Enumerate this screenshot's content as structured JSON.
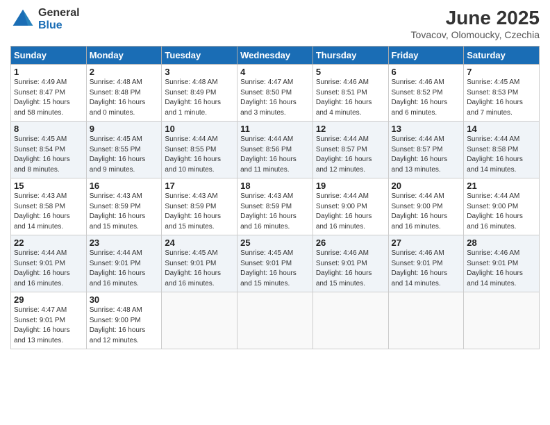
{
  "logo": {
    "general": "General",
    "blue": "Blue"
  },
  "title": "June 2025",
  "subtitle": "Tovacov, Olomoucky, Czechia",
  "days_of_week": [
    "Sunday",
    "Monday",
    "Tuesday",
    "Wednesday",
    "Thursday",
    "Friday",
    "Saturday"
  ],
  "weeks": [
    [
      {
        "day": "1",
        "info": "Sunrise: 4:49 AM\nSunset: 8:47 PM\nDaylight: 15 hours\nand 58 minutes."
      },
      {
        "day": "2",
        "info": "Sunrise: 4:48 AM\nSunset: 8:48 PM\nDaylight: 16 hours\nand 0 minutes."
      },
      {
        "day": "3",
        "info": "Sunrise: 4:48 AM\nSunset: 8:49 PM\nDaylight: 16 hours\nand 1 minute."
      },
      {
        "day": "4",
        "info": "Sunrise: 4:47 AM\nSunset: 8:50 PM\nDaylight: 16 hours\nand 3 minutes."
      },
      {
        "day": "5",
        "info": "Sunrise: 4:46 AM\nSunset: 8:51 PM\nDaylight: 16 hours\nand 4 minutes."
      },
      {
        "day": "6",
        "info": "Sunrise: 4:46 AM\nSunset: 8:52 PM\nDaylight: 16 hours\nand 6 minutes."
      },
      {
        "day": "7",
        "info": "Sunrise: 4:45 AM\nSunset: 8:53 PM\nDaylight: 16 hours\nand 7 minutes."
      }
    ],
    [
      {
        "day": "8",
        "info": "Sunrise: 4:45 AM\nSunset: 8:54 PM\nDaylight: 16 hours\nand 8 minutes."
      },
      {
        "day": "9",
        "info": "Sunrise: 4:45 AM\nSunset: 8:55 PM\nDaylight: 16 hours\nand 9 minutes."
      },
      {
        "day": "10",
        "info": "Sunrise: 4:44 AM\nSunset: 8:55 PM\nDaylight: 16 hours\nand 10 minutes."
      },
      {
        "day": "11",
        "info": "Sunrise: 4:44 AM\nSunset: 8:56 PM\nDaylight: 16 hours\nand 11 minutes."
      },
      {
        "day": "12",
        "info": "Sunrise: 4:44 AM\nSunset: 8:57 PM\nDaylight: 16 hours\nand 12 minutes."
      },
      {
        "day": "13",
        "info": "Sunrise: 4:44 AM\nSunset: 8:57 PM\nDaylight: 16 hours\nand 13 minutes."
      },
      {
        "day": "14",
        "info": "Sunrise: 4:44 AM\nSunset: 8:58 PM\nDaylight: 16 hours\nand 14 minutes."
      }
    ],
    [
      {
        "day": "15",
        "info": "Sunrise: 4:43 AM\nSunset: 8:58 PM\nDaylight: 16 hours\nand 14 minutes."
      },
      {
        "day": "16",
        "info": "Sunrise: 4:43 AM\nSunset: 8:59 PM\nDaylight: 16 hours\nand 15 minutes."
      },
      {
        "day": "17",
        "info": "Sunrise: 4:43 AM\nSunset: 8:59 PM\nDaylight: 16 hours\nand 15 minutes."
      },
      {
        "day": "18",
        "info": "Sunrise: 4:43 AM\nSunset: 8:59 PM\nDaylight: 16 hours\nand 16 minutes."
      },
      {
        "day": "19",
        "info": "Sunrise: 4:44 AM\nSunset: 9:00 PM\nDaylight: 16 hours\nand 16 minutes."
      },
      {
        "day": "20",
        "info": "Sunrise: 4:44 AM\nSunset: 9:00 PM\nDaylight: 16 hours\nand 16 minutes."
      },
      {
        "day": "21",
        "info": "Sunrise: 4:44 AM\nSunset: 9:00 PM\nDaylight: 16 hours\nand 16 minutes."
      }
    ],
    [
      {
        "day": "22",
        "info": "Sunrise: 4:44 AM\nSunset: 9:01 PM\nDaylight: 16 hours\nand 16 minutes."
      },
      {
        "day": "23",
        "info": "Sunrise: 4:44 AM\nSunset: 9:01 PM\nDaylight: 16 hours\nand 16 minutes."
      },
      {
        "day": "24",
        "info": "Sunrise: 4:45 AM\nSunset: 9:01 PM\nDaylight: 16 hours\nand 16 minutes."
      },
      {
        "day": "25",
        "info": "Sunrise: 4:45 AM\nSunset: 9:01 PM\nDaylight: 16 hours\nand 15 minutes."
      },
      {
        "day": "26",
        "info": "Sunrise: 4:46 AM\nSunset: 9:01 PM\nDaylight: 16 hours\nand 15 minutes."
      },
      {
        "day": "27",
        "info": "Sunrise: 4:46 AM\nSunset: 9:01 PM\nDaylight: 16 hours\nand 14 minutes."
      },
      {
        "day": "28",
        "info": "Sunrise: 4:46 AM\nSunset: 9:01 PM\nDaylight: 16 hours\nand 14 minutes."
      }
    ],
    [
      {
        "day": "29",
        "info": "Sunrise: 4:47 AM\nSunset: 9:01 PM\nDaylight: 16 hours\nand 13 minutes."
      },
      {
        "day": "30",
        "info": "Sunrise: 4:48 AM\nSunset: 9:00 PM\nDaylight: 16 hours\nand 12 minutes."
      },
      {
        "day": "",
        "info": ""
      },
      {
        "day": "",
        "info": ""
      },
      {
        "day": "",
        "info": ""
      },
      {
        "day": "",
        "info": ""
      },
      {
        "day": "",
        "info": ""
      }
    ]
  ]
}
